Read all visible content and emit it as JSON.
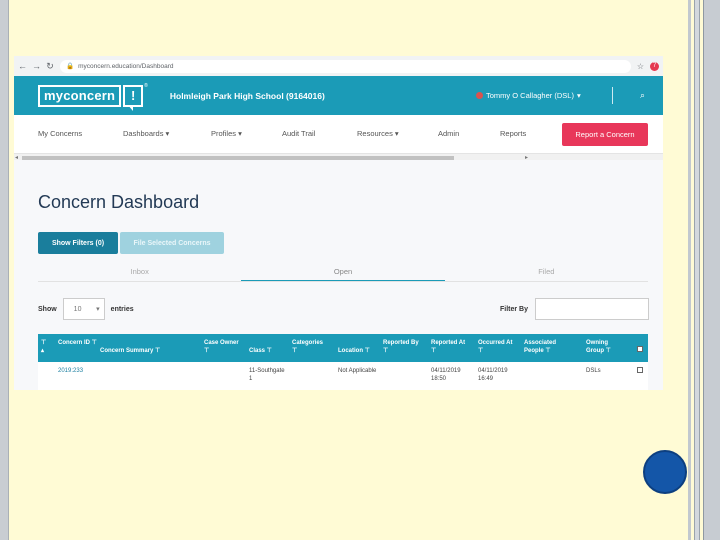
{
  "browser": {
    "url": "myconcern.education/Dashboard",
    "extension_badge": "7"
  },
  "header": {
    "logo_text": "myconcern",
    "logo_mark": "!",
    "trademark": "®",
    "school": "Holmleigh Park High School (9164016)",
    "user": "Tommy O Callagher (DSL)"
  },
  "menu": {
    "items": [
      "My Concerns",
      "Dashboards ▾",
      "Profiles ▾",
      "Audit Trail",
      "Resources ▾",
      "Admin",
      "Reports"
    ],
    "report_button": "Report a Concern"
  },
  "page": {
    "title": "Concern Dashboard",
    "show_filters_label": "Show Filters (0)",
    "file_selected_label": "File Selected Concerns",
    "tabs": [
      "Inbox",
      "Open",
      "Filed"
    ],
    "active_tab": "Open",
    "show_label": "Show",
    "entries_value": "10",
    "entries_label": "entries",
    "filter_label": "Filter By"
  },
  "table": {
    "headers": [
      "Concern ID",
      "Concern Summary",
      "Case Owner",
      "Class",
      "Categories",
      "Location",
      "Reported By",
      "Reported At",
      "Occurred At",
      "Associated People",
      "Owning Group"
    ],
    "rows": [
      {
        "concern_id": "2019:233",
        "summary": "",
        "case_owner": "",
        "class": "11-Southgate",
        "class_extra": "1",
        "categories": "",
        "location": "Not Applicable",
        "reported_by": "",
        "reported_at": "04/11/2019 18:50",
        "occurred_at": "04/11/2019 16:49",
        "associated_people": "",
        "owning_group": "DSLs"
      }
    ]
  }
}
